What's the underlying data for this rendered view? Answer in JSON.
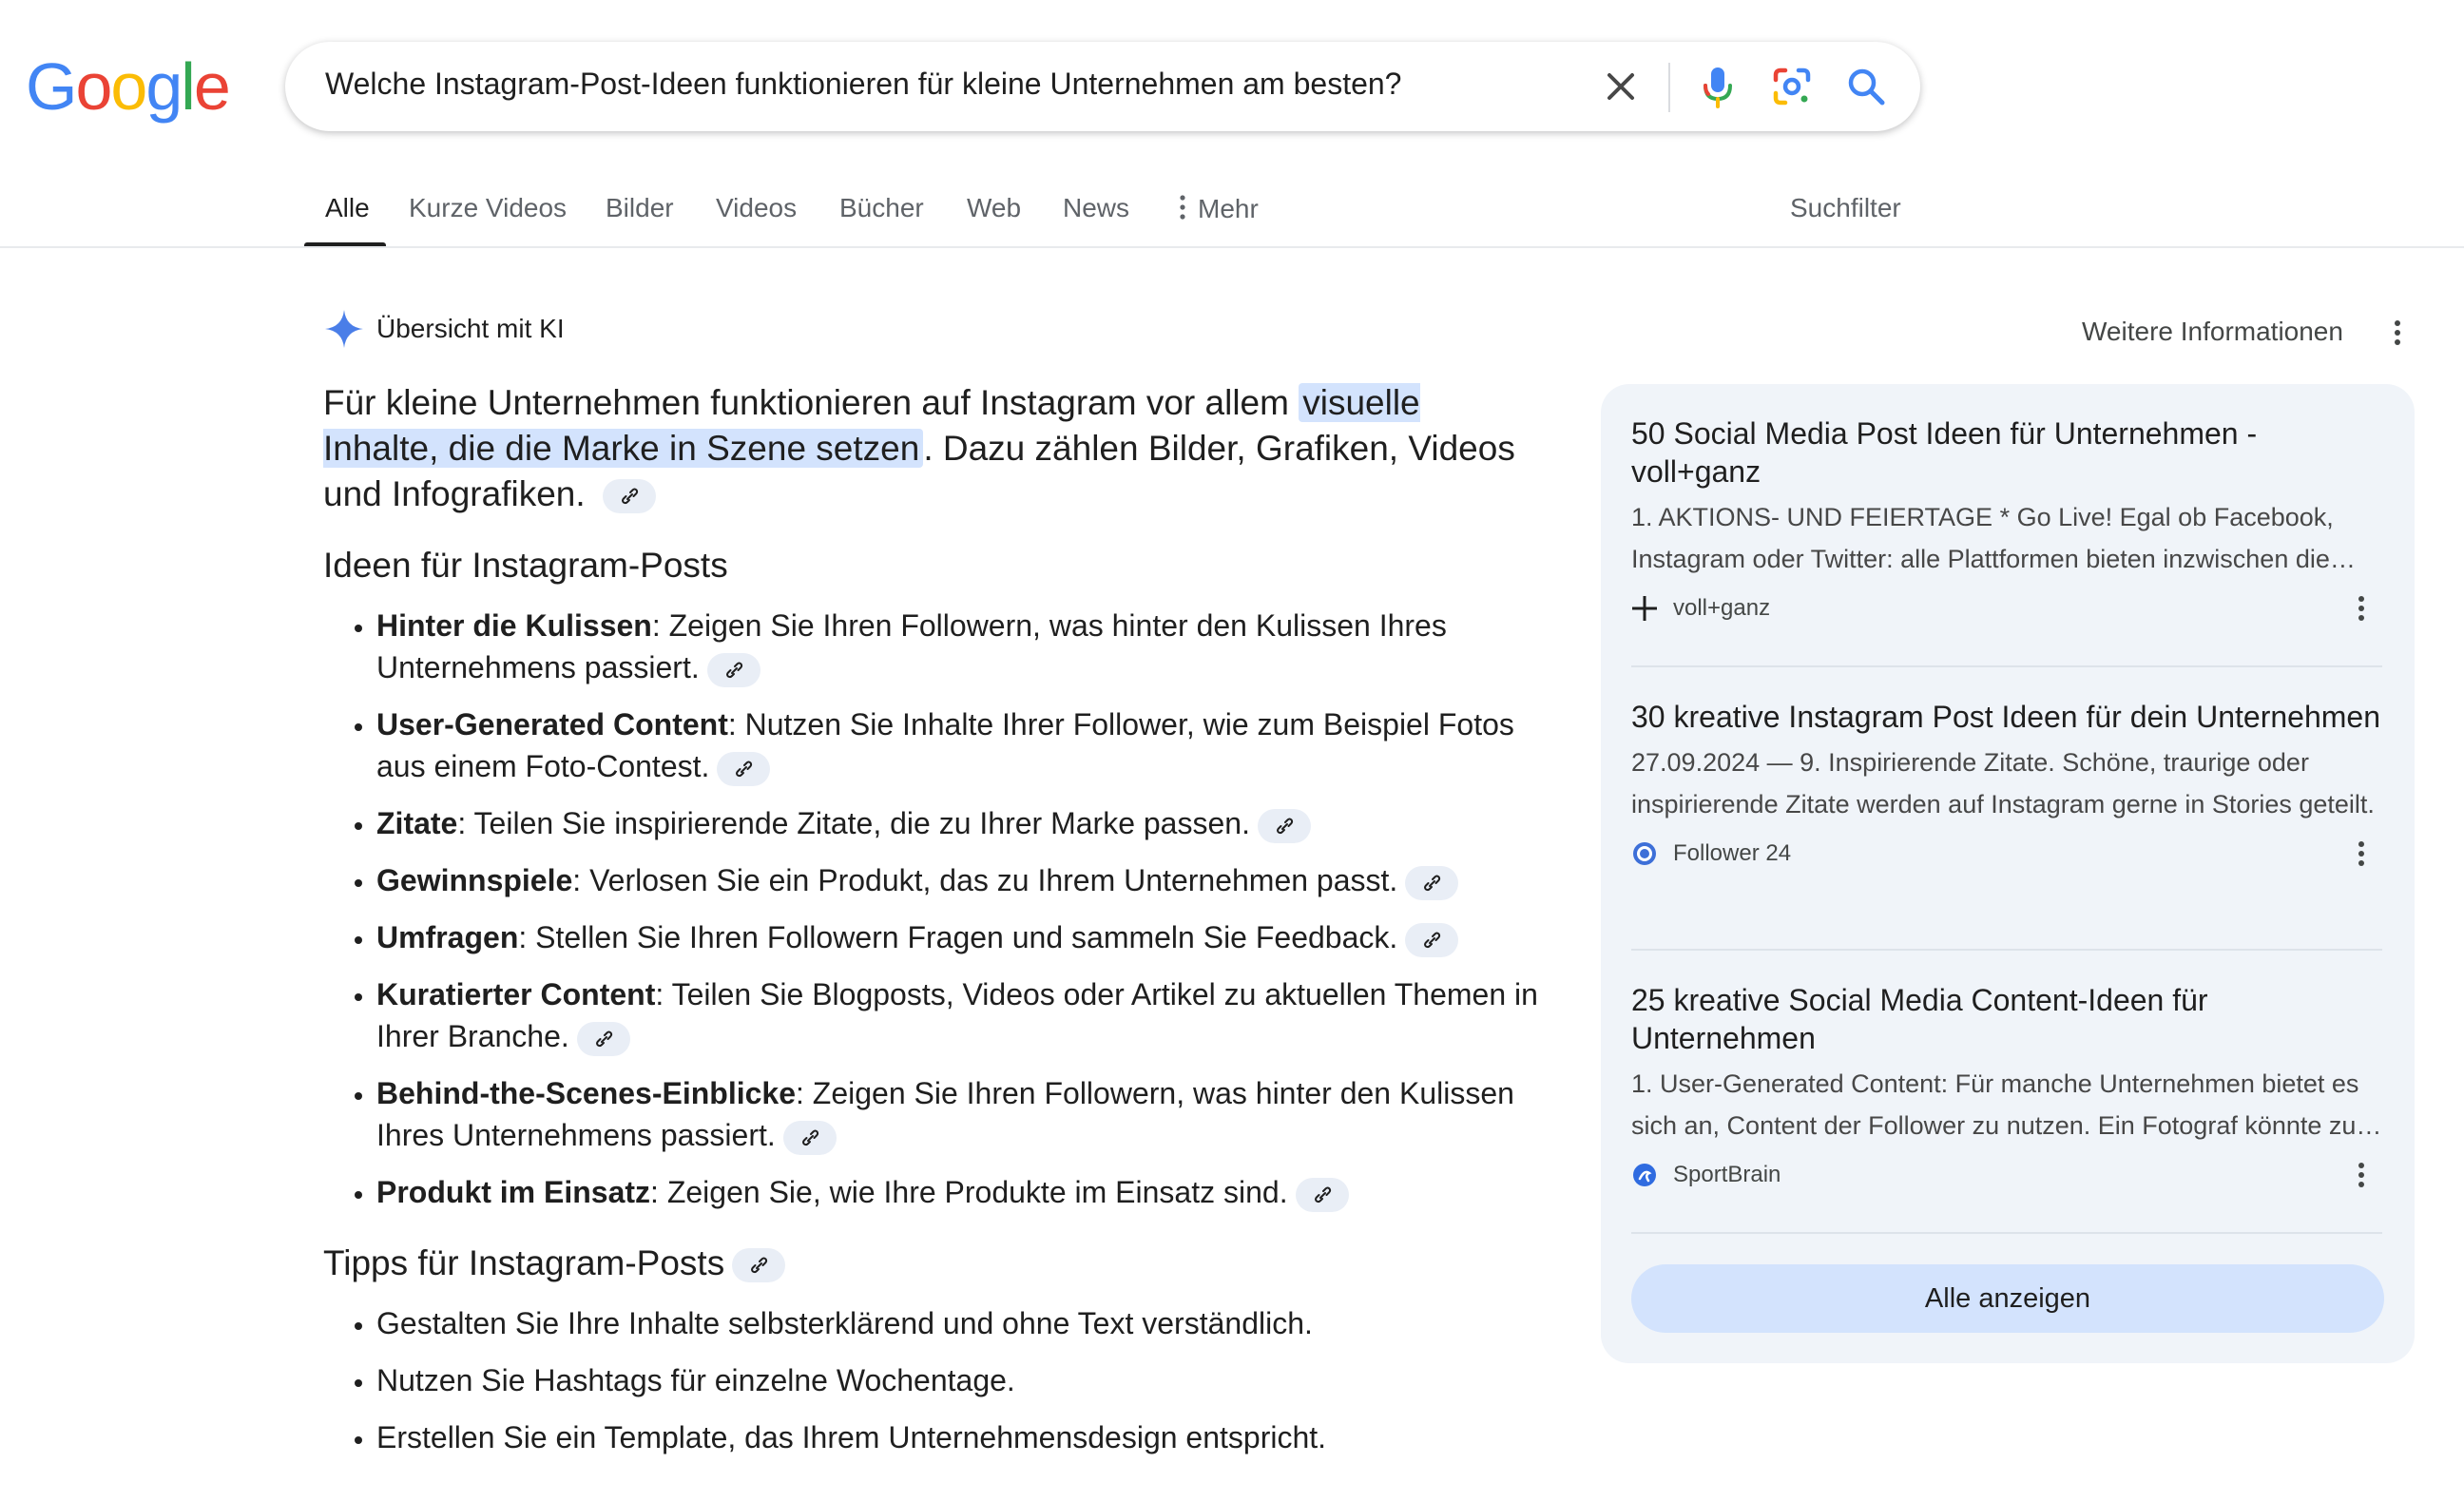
{
  "logo": {
    "letters": [
      "G",
      "o",
      "o",
      "g",
      "l",
      "e"
    ],
    "colors": [
      "#4285F4",
      "#EA4335",
      "#FBBC05",
      "#4285F4",
      "#34A853",
      "#EA4335"
    ]
  },
  "search": {
    "query": "Welche Instagram-Post-Ideen funktionieren für kleine Unternehmen am besten?"
  },
  "icons": {
    "clear": "close-icon",
    "voice": "microphone-icon",
    "lens": "google-lens-icon",
    "search": "search-icon"
  },
  "tabs": [
    {
      "label": "Alle",
      "active": true
    },
    {
      "label": "Kurze Videos"
    },
    {
      "label": "Bilder"
    },
    {
      "label": "Videos"
    },
    {
      "label": "Bücher"
    },
    {
      "label": "Web"
    },
    {
      "label": "News"
    },
    {
      "label": "Mehr"
    }
  ],
  "search_filter": "Suchfilter",
  "ai_overview": {
    "title": "Übersicht mit KI",
    "more_info": "Weitere Informationen",
    "lead": {
      "pre": "Für kleine Unternehmen funktionieren auf Instagram vor allem ",
      "highlight": "visuelle Inhalte, die die Marke in Szene setzen",
      "post": ". Dazu zählen Bilder, Grafiken, Videos und Infografiken."
    },
    "ideas_heading": "Ideen für Instagram-Posts",
    "ideas": [
      {
        "bold": "Hinter die Kulissen",
        "text": ": Zeigen Sie Ihren Followern, was hinter den Kulissen Ihres Unternehmens passiert."
      },
      {
        "bold": "User-Generated Content",
        "text": ": Nutzen Sie Inhalte Ihrer Follower, wie zum Beispiel Fotos aus einem Foto-Contest."
      },
      {
        "bold": "Zitate",
        "text": ": Teilen Sie inspirierende Zitate, die zu Ihrer Marke passen."
      },
      {
        "bold": "Gewinnspiele",
        "text": ": Verlosen Sie ein Produkt, das zu Ihrem Unternehmen passt."
      },
      {
        "bold": "Umfragen",
        "text": ": Stellen Sie Ihren Followern Fragen und sammeln Sie Feedback."
      },
      {
        "bold": "Kuratierter Content",
        "text": ": Teilen Sie Blogposts, Videos oder Artikel zu aktuellen Themen in Ihrer Branche."
      },
      {
        "bold": "Behind-the-Scenes-Einblicke",
        "text": ": Zeigen Sie Ihren Followern, was hinter den Kulissen Ihres Unternehmens passiert."
      },
      {
        "bold": "Produkt im Einsatz",
        "text": ": Zeigen Sie, wie Ihre Produkte im Einsatz sind."
      }
    ],
    "tips_heading": "Tipps für Instagram-Posts",
    "tips": [
      "Gestalten Sie Ihre Inhalte selbsterklärend und ohne Text verständlich.",
      "Nutzen Sie Hashtags für einzelne Wochentage.",
      "Erstellen Sie ein Template, das Ihrem Unternehmensdesign entspricht."
    ]
  },
  "sources": [
    {
      "title": "50 Social Media Post Ideen für Unternehmen - voll+ganz",
      "snippet": "1. AKTIONS- UND FEIERTAGE * Go Live! Egal ob Facebook, Instagram oder Twitter: alle Plattformen bieten inzwischen die Möglichkeit, live zu gehen.",
      "site": "voll+ganz",
      "favicon": "plus-logo-icon"
    },
    {
      "title": "30 kreative Instagram Post Ideen für dein Unternehmen",
      "snippet": "27.09.2024 — 9. Inspirierende Zitate. Schöne, traurige oder inspirierende Zitate werden auf Instagram gerne in Stories geteilt.",
      "site": "Follower 24",
      "favicon": "follower24-logo-icon"
    },
    {
      "title": "25 kreative Social Media Content-Ideen für Unternehmen",
      "snippet": "1. User-Generated Content: Für manche Unternehmen bietet es sich an, Content der Follower zu nutzen. Ein Fotograf könnte zum Beispiel",
      "site": "SportBrain",
      "favicon": "sportbrain-logo-icon"
    }
  ],
  "show_all": "Alle anzeigen"
}
